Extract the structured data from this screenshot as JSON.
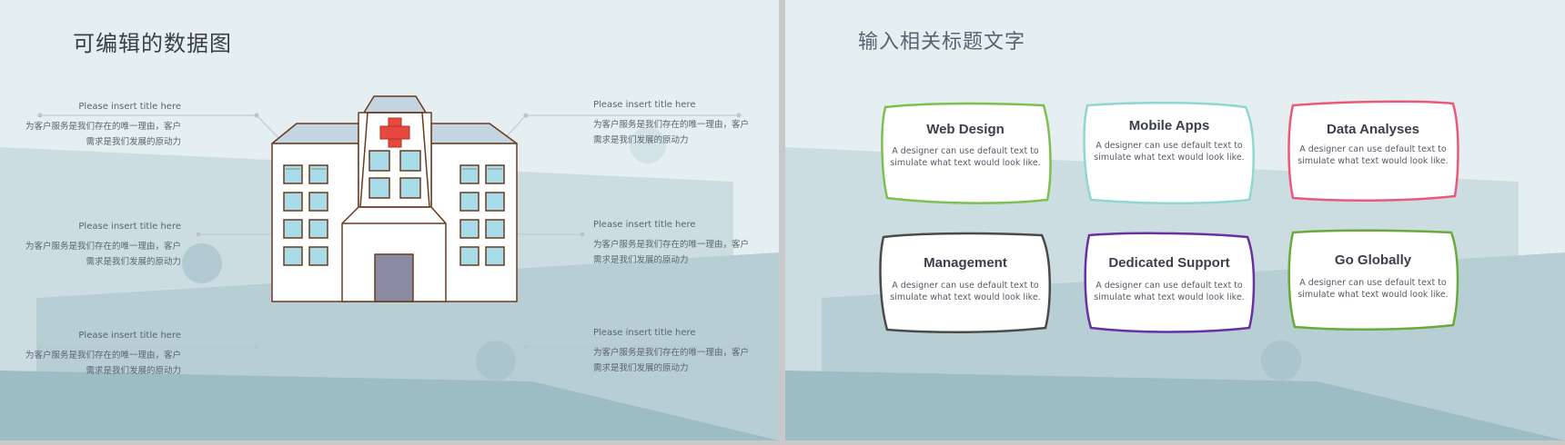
{
  "left_slide": {
    "title": "可编辑的数据图",
    "items": [
      {
        "title": "Please insert title here",
        "desc": "为客户服务是我们存在的唯一理由，客户需求是我们发展的原动力"
      },
      {
        "title": "Please insert title here",
        "desc": "为客户服务是我们存在的唯一理由，客户需求是我们发展的原动力"
      },
      {
        "title": "Please insert title here",
        "desc": "为客户服务是我们存在的唯一理由，客户需求是我们发展的原动力"
      },
      {
        "title": "Please insert title here",
        "desc": "为客户服务是我们存在的唯一理由，客户需求是我们发展的原动力"
      },
      {
        "title": "Please insert title here",
        "desc": "为客户服务是我们存在的唯一理由，客户需求是我们发展的原动力"
      },
      {
        "title": "Please insert title here",
        "desc": "为客户服务是我们存在的唯一理由，客户需求是我们发展的原动力"
      }
    ],
    "illustration_icon": "hospital-icon"
  },
  "right_slide": {
    "title": "输入相关标题文字",
    "cards": [
      {
        "title": "Web Design",
        "desc": "A designer can use default text to simulate what text would look like.",
        "color": "#7cc04f"
      },
      {
        "title": "Mobile Apps",
        "desc": "A designer can use default text to simulate what text would look like.",
        "color": "#8fd8cf"
      },
      {
        "title": "Data Analyses",
        "desc": "A designer can use default text to simulate what text would look like.",
        "color": "#ea5a78"
      },
      {
        "title": "Management",
        "desc": "A designer can use default text to simulate what text would look like.",
        "color": "#4a4a4a"
      },
      {
        "title": "Dedicated Support",
        "desc": "A designer can use default text to simulate what text would look like.",
        "color": "#6a2fa0"
      },
      {
        "title": "Go Globally",
        "desc": "A designer can use default text to simulate what text would look like.",
        "color": "#6aaa3a"
      }
    ]
  },
  "colors": {
    "background": "#e5eef0",
    "band_light": "#ccdde2",
    "band_mid": "#b7ced5",
    "band_dark": "#9dbdc4",
    "hospital_cross": "#e8483e",
    "hospital_window": "#a9dce9",
    "hospital_roof": "#c4d5e2",
    "hospital_door": "#8a8aa3"
  }
}
